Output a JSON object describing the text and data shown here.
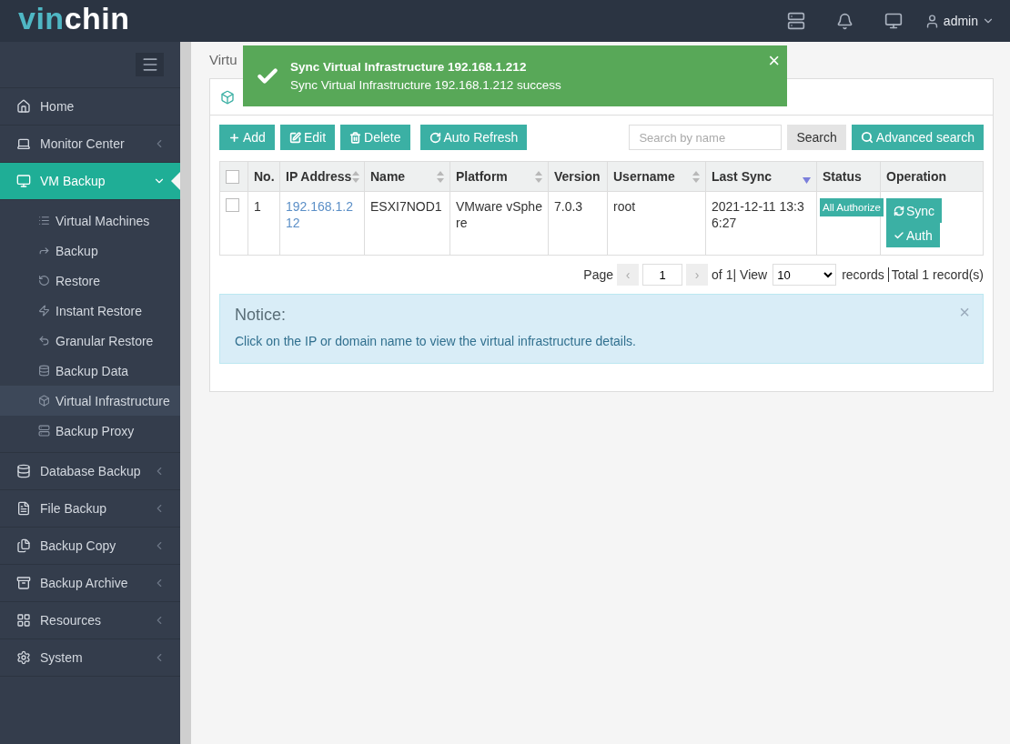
{
  "logo": {
    "accent": "vin",
    "rest": "chin"
  },
  "topbar": {
    "user": "admin"
  },
  "sidebar": {
    "items": [
      {
        "label": "Home",
        "kind": "link",
        "selected": false
      },
      {
        "label": "Monitor Center",
        "kind": "menu",
        "selected": false,
        "expanded": false
      },
      {
        "label": "VM Backup",
        "kind": "menu",
        "selected": true,
        "expanded": true,
        "children": [
          {
            "label": "Virtual Machines",
            "selected": false
          },
          {
            "label": "Backup",
            "selected": false
          },
          {
            "label": "Restore",
            "selected": false
          },
          {
            "label": "Instant Restore",
            "selected": false
          },
          {
            "label": "Granular Restore",
            "selected": false
          },
          {
            "label": "Backup Data",
            "selected": false
          },
          {
            "label": "Virtual Infrastructure",
            "selected": true
          },
          {
            "label": "Backup Proxy",
            "selected": false
          }
        ]
      },
      {
        "label": "Database Backup",
        "kind": "menu",
        "selected": false,
        "expanded": false
      },
      {
        "label": "File Backup",
        "kind": "menu",
        "selected": false,
        "expanded": false
      },
      {
        "label": "Backup Copy",
        "kind": "menu",
        "selected": false,
        "expanded": false
      },
      {
        "label": "Backup Archive",
        "kind": "menu",
        "selected": false,
        "expanded": false
      },
      {
        "label": "Resources",
        "kind": "menu",
        "selected": false,
        "expanded": false
      },
      {
        "label": "System",
        "kind": "menu",
        "selected": false,
        "expanded": false
      }
    ]
  },
  "breadcrumb": "Virtu",
  "toolbar": {
    "buttons": [
      {
        "label": "Add",
        "kind": "add"
      },
      {
        "label": "Edit",
        "kind": "edit"
      },
      {
        "label": "Delete",
        "kind": "delete"
      },
      {
        "label": "Auto Refresh",
        "kind": "refresh"
      }
    ],
    "search": {
      "placeholder": "Search by name"
    },
    "search_button": "Search",
    "advanced_button": "Advanced search"
  },
  "table": {
    "all_checked": false,
    "columns": [
      {
        "kind": "check",
        "sortable": false,
        "sorted": false
      },
      {
        "label": "No.",
        "kind": "text",
        "sortable": false,
        "sorted": false
      },
      {
        "label": "IP Address",
        "kind": "text",
        "sortable": true,
        "sorted": false
      },
      {
        "label": "Name",
        "kind": "text",
        "sortable": true,
        "sorted": false
      },
      {
        "label": "Platform",
        "kind": "text",
        "sortable": true,
        "sorted": false
      },
      {
        "label": "Version",
        "kind": "text",
        "sortable": false,
        "sorted": false
      },
      {
        "label": "Username",
        "kind": "text",
        "sortable": true,
        "sorted": false
      },
      {
        "label": "Last Sync",
        "kind": "text",
        "sortable": false,
        "sorted": true
      },
      {
        "label": "Status",
        "kind": "text",
        "sortable": false,
        "sorted": false
      },
      {
        "label": "Operation",
        "kind": "text",
        "sortable": false,
        "sorted": false
      }
    ],
    "rows": [
      {
        "checked": false,
        "no": "1",
        "ip": "192.168.1.212",
        "name": "ESXI7NOD1",
        "platform": "VMware vSphere",
        "version": "7.0.3",
        "username": "root",
        "last_sync": "2021-12-11 13:36:27",
        "status": "All Authorize",
        "operations": [
          {
            "label": "Sync",
            "kind": "sync"
          },
          {
            "label": "Auth",
            "kind": "auth"
          }
        ]
      }
    ]
  },
  "pagination": {
    "page_label": "Page",
    "prev": "‹",
    "page": "1",
    "next": "›",
    "of": "of 1|",
    "view": "View",
    "per_page": "10",
    "records": "records",
    "total": "Total 1 record(s)"
  },
  "notice": {
    "title": "Notice:",
    "text": "Click on the IP or domain name to view the virtual infrastructure details.",
    "close": "×"
  },
  "toast": {
    "title": "Sync Virtual Infrastructure 192.168.1.212",
    "message": "Sync Virtual Infrastructure 192.168.1.212 success",
    "close": "×"
  }
}
